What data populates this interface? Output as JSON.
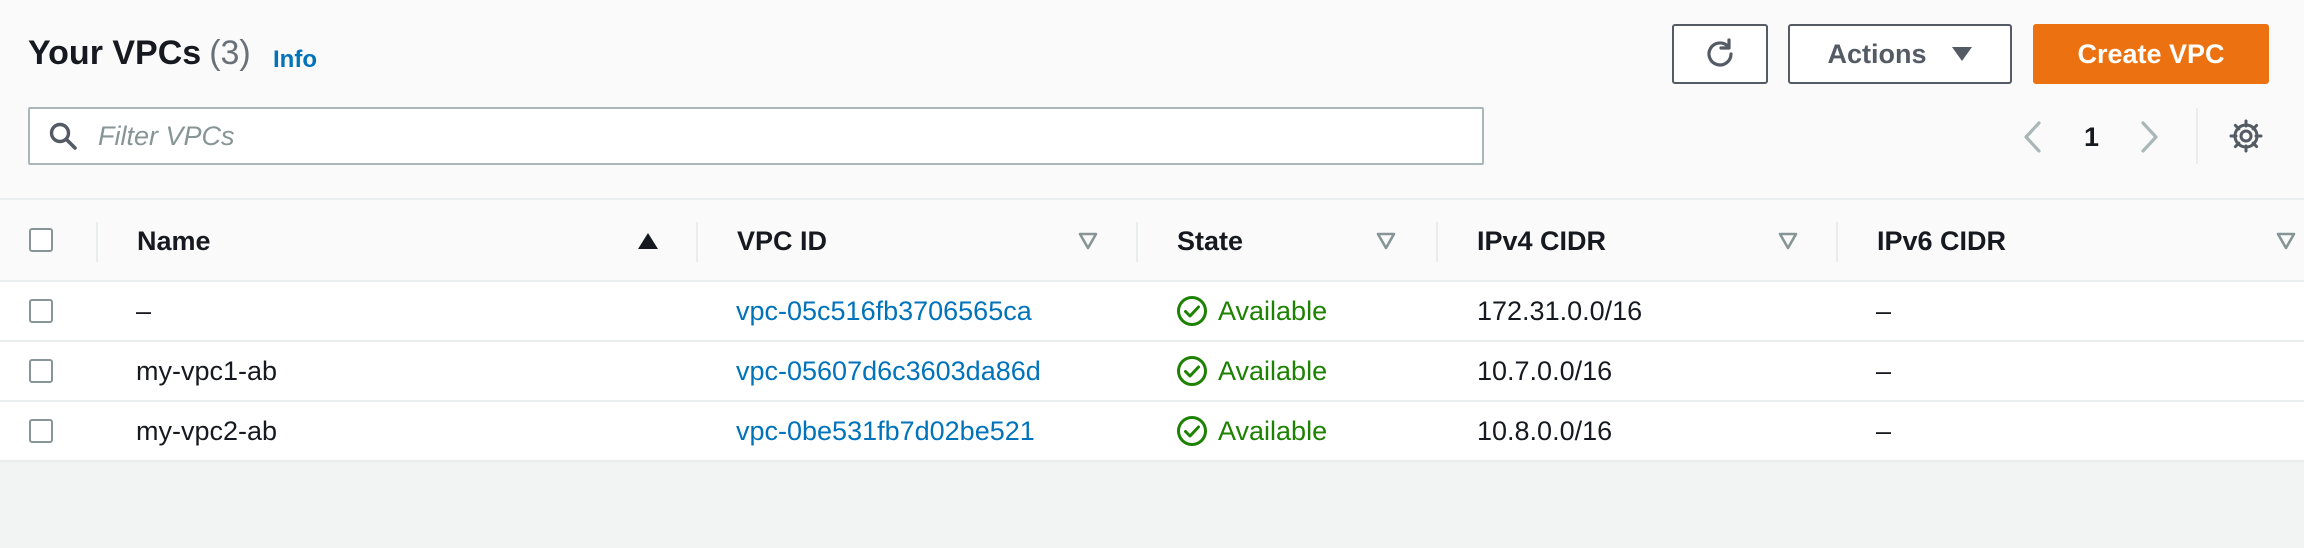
{
  "header": {
    "title": "Your VPCs",
    "count": "(3)",
    "info_label": "Info"
  },
  "toolbar": {
    "refresh_icon": "refresh-icon",
    "actions_label": "Actions",
    "create_label": "Create VPC",
    "create_color": "#ec7211"
  },
  "filter": {
    "placeholder": "Filter VPCs",
    "value": ""
  },
  "pagination": {
    "current_page": "1"
  },
  "table": {
    "columns": {
      "name": "Name",
      "vpc_id": "VPC ID",
      "state": "State",
      "ipv4": "IPv4 CIDR",
      "ipv6": "IPv6 CIDR"
    },
    "rows": [
      {
        "name": "–",
        "vpc_id": "vpc-05c516fb3706565ca",
        "state": "Available",
        "ipv4": "172.31.0.0/16",
        "ipv6": "–"
      },
      {
        "name": "my-vpc1-ab",
        "vpc_id": "vpc-05607d6c3603da86d",
        "state": "Available",
        "ipv4": "10.7.0.0/16",
        "ipv6": "–"
      },
      {
        "name": "my-vpc2-ab",
        "vpc_id": "vpc-0be531fb7d02be521",
        "state": "Available",
        "ipv4": "10.8.0.0/16",
        "ipv6": "–"
      }
    ]
  },
  "colors": {
    "link": "#0073bb",
    "success": "#1d8102",
    "primary": "#ec7211"
  }
}
